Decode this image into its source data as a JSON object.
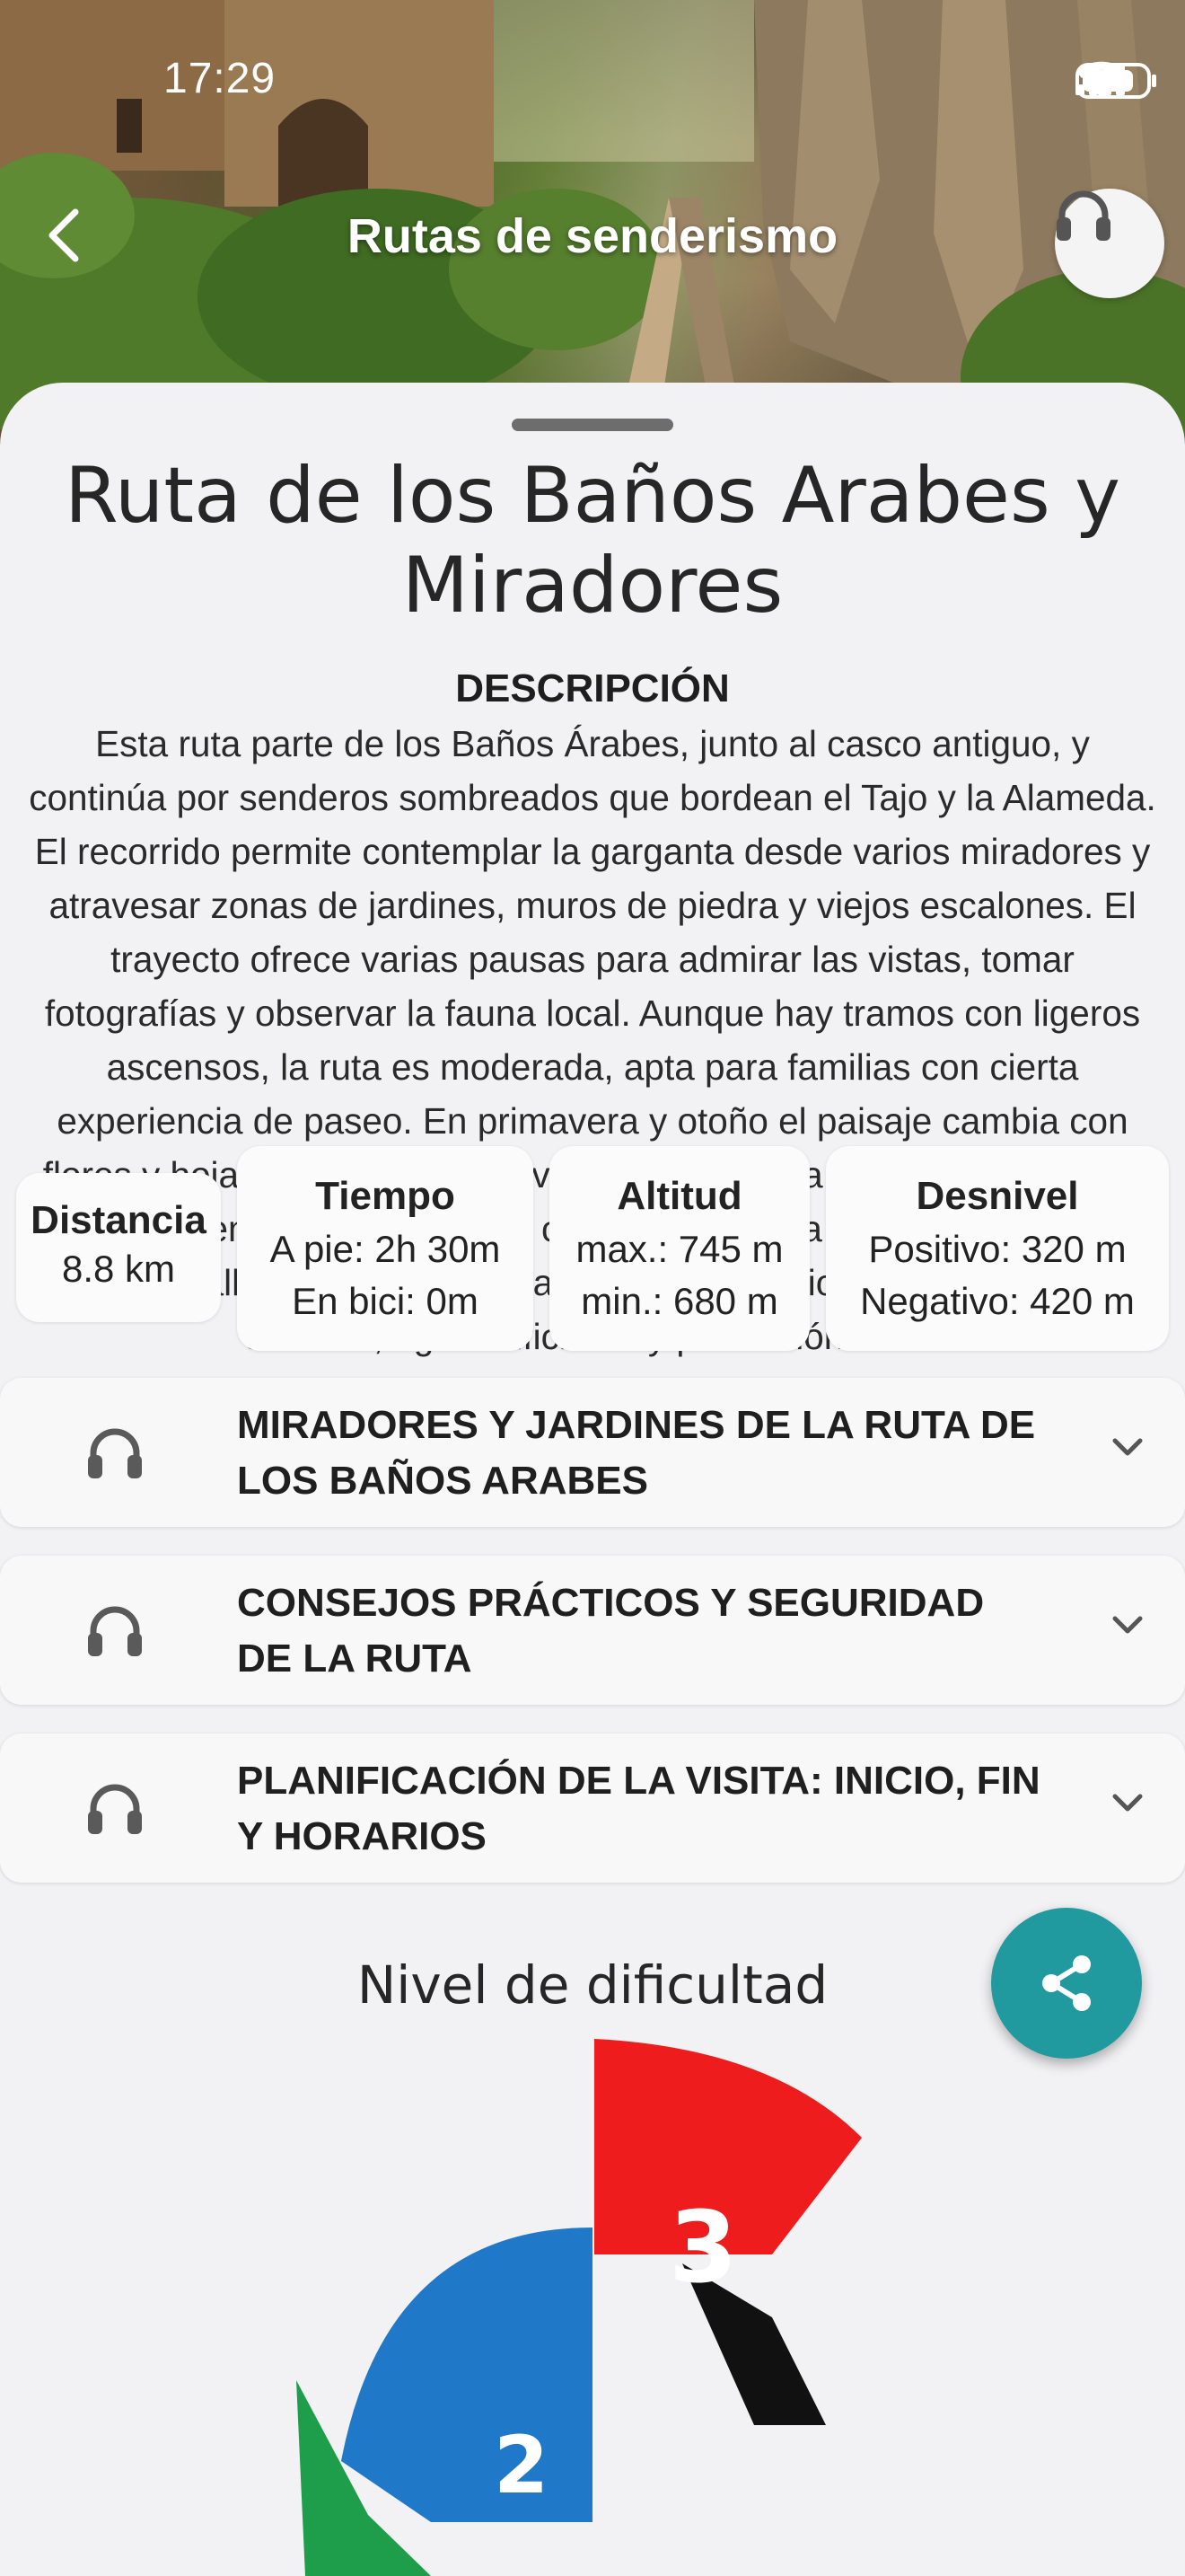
{
  "status_bar": {
    "time": "17:29"
  },
  "header": {
    "title": "Rutas de senderismo"
  },
  "route": {
    "title": "Ruta de los Baños Arabes y Miradores",
    "description_heading": "DESCRIPCIÓN",
    "description": "Esta ruta parte de los Baños Árabes, junto al casco antiguo, y continúa por senderos sombreados que bordean el Tajo y la Alameda. El recorrido permite contemplar la garganta desde varios miradores y atravesar zonas de jardines, muros de piedra y viejos escalones. El trayecto ofrece varias pausas para admirar las vistas, tomar fotografías y observar la fauna local. Aunque hay tramos con ligeros ascensos, la ruta es moderada, apta para familias con cierta experiencia de paseo. En primavera y otoño el paisaje cambia con flores y hojas multicolores; en verano, la sombra de los Algarrobos y pinos es bienvenida. Al final, el camino regresa a los Baños Arabes y, desde allí, se llega de vuelta al punto de inicio. Llevar calzado cómodo, agua suficiente y protección solar."
  },
  "stats": {
    "distance": {
      "label": "Distancia",
      "value": "8.8 km"
    },
    "time": {
      "label": "Tiempo",
      "walk": "A pie: 2h 30m",
      "bike": "En bici: 0m"
    },
    "altitude": {
      "label": "Altitud",
      "max": "max.: 745 m",
      "min": "min.: 680 m"
    },
    "elevation": {
      "label": "Desnivel",
      "positive": "Positivo: 320 m",
      "negative": "Negativo: 420 m"
    }
  },
  "sections": [
    {
      "label": "MIRADORES Y JARDINES DE LA RUTA DE LOS BAÑOS ARABES"
    },
    {
      "label": "CONSEJOS PRÁCTICOS Y SEGURIDAD DE LA RUTA"
    },
    {
      "label": "PLANIFICACIÓN DE LA VISITA: INICIO, FIN Y HORARIOS"
    }
  ],
  "difficulty": {
    "title": "Nivel de dificultad",
    "segments": [
      "2",
      "3"
    ],
    "colors": {
      "green": "#1e9e4a",
      "blue": "#1f78c8",
      "red": "#ee1c1c",
      "black": "#111111"
    }
  },
  "icons": {
    "back": "chevron-left-icon",
    "audio": "headphones-icon",
    "expand": "chevron-down-icon",
    "share": "share-icon"
  },
  "colors": {
    "accent": "#20999f",
    "background": "#f2f2f4"
  }
}
